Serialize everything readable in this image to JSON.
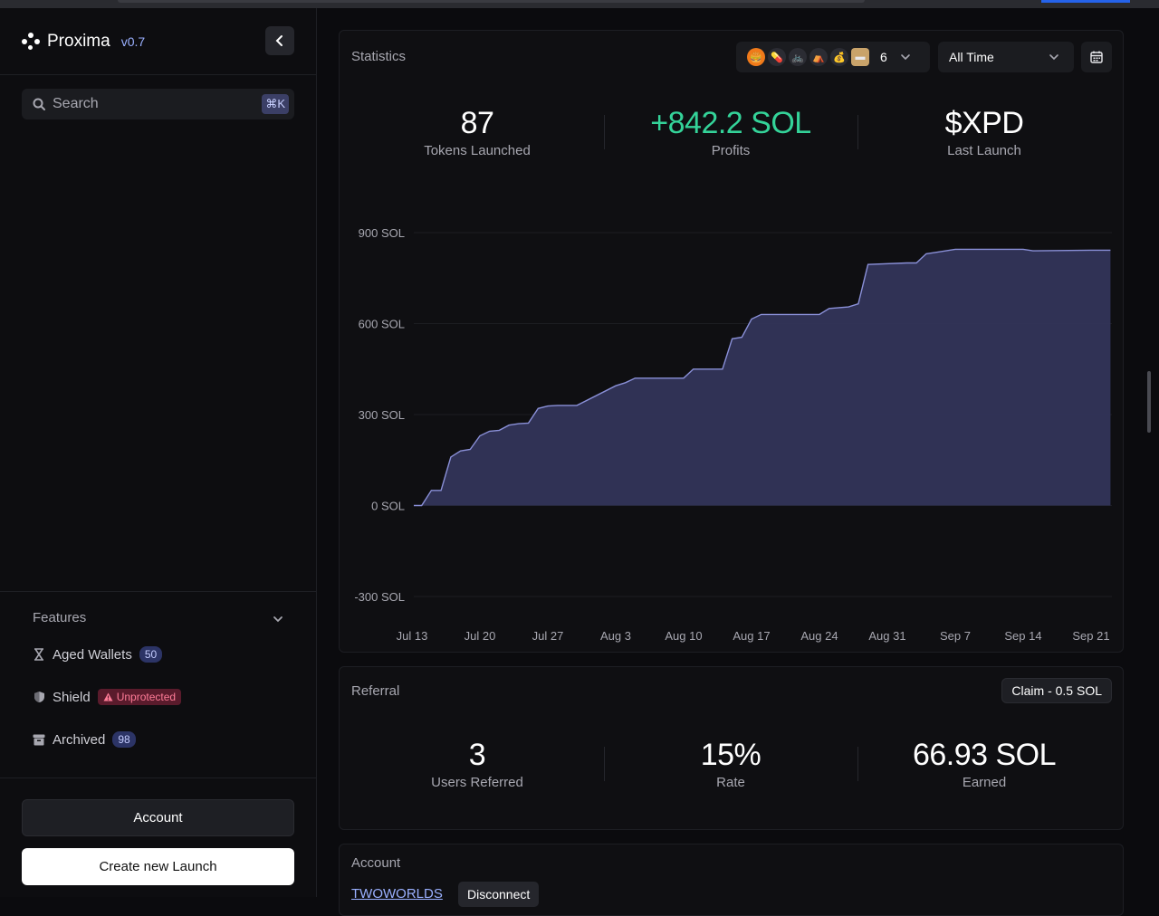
{
  "brand": {
    "name": "Proxima",
    "version": "v0.7"
  },
  "search": {
    "placeholder": "Search",
    "shortcut": "⌘K"
  },
  "features": {
    "title": "Features",
    "items": [
      {
        "label": "Aged Wallets",
        "badge": "50",
        "icon": "hourglass-icon"
      },
      {
        "label": "Shield",
        "badge": "Unprotected",
        "icon": "shield-icon"
      },
      {
        "label": "Archived",
        "badge": "98",
        "icon": "archive-icon"
      }
    ]
  },
  "buttons": {
    "account": "Account",
    "create": "Create new Launch"
  },
  "statistics": {
    "title": "Statistics",
    "token_count": "6",
    "range": "All Time",
    "stats": [
      {
        "value": "87",
        "label": "Tokens Launched"
      },
      {
        "value": "+842.2 SOL",
        "label": "Profits"
      },
      {
        "value": "$XPD",
        "label": "Last Launch"
      }
    ]
  },
  "referral": {
    "title": "Referral",
    "claim": "Claim - 0.5 SOL",
    "stats": [
      {
        "value": "3",
        "label": "Users Referred"
      },
      {
        "value": "15%",
        "label": "Rate"
      },
      {
        "value": "66.93 SOL",
        "label": "Earned"
      }
    ]
  },
  "account_section": {
    "title": "Account",
    "name": "TWOWORLDS",
    "disconnect": "Disconnect"
  },
  "colors": {
    "profit": "#34d399",
    "area_fill": "#33355a",
    "area_line": "#8a90d8",
    "accent": "#9ab0ff"
  },
  "chart_data": {
    "type": "area",
    "yticks": [
      "900 SOL",
      "600 SOL",
      "300 SOL",
      "0 SOL",
      "-300 SOL"
    ],
    "ytick_values": [
      900,
      600,
      300,
      0,
      -300
    ],
    "ylim": [
      -300,
      900
    ],
    "xticks": [
      "Jul 13",
      "Jul 20",
      "Jul 27",
      "Aug 3",
      "Aug 10",
      "Aug 17",
      "Aug 24",
      "Aug 31",
      "Sep 7",
      "Sep 14",
      "Sep 21"
    ],
    "series": [
      {
        "x": [
          "Jul 13",
          "Jul 14",
          "Jul 15",
          "Jul 16",
          "Jul 17",
          "Jul 18",
          "Jul 19",
          "Jul 20",
          "Jul 21",
          "Jul 22",
          "Jul 23",
          "Jul 24",
          "Jul 25",
          "Jul 26",
          "Jul 27",
          "Jul 28",
          "Jul 29",
          "Jul 30",
          "Aug 3",
          "Aug 4",
          "Aug 5",
          "Aug 7",
          "Aug 10",
          "Aug 11",
          "Aug 14",
          "Aug 15",
          "Aug 16",
          "Aug 17",
          "Aug 18",
          "Aug 24",
          "Aug 25",
          "Aug 27",
          "Aug 28",
          "Aug 29",
          "Sep 2",
          "Sep 3",
          "Sep 4",
          "Sep 5",
          "Sep 7",
          "Sep 14",
          "Sep 15",
          "Sep 21",
          "Sep 23"
        ],
        "values": [
          0,
          0,
          50,
          50,
          160,
          180,
          185,
          230,
          245,
          248,
          265,
          270,
          272,
          320,
          328,
          330,
          330,
          330,
          395,
          405,
          420,
          420,
          420,
          450,
          450,
          550,
          555,
          615,
          630,
          630,
          650,
          655,
          665,
          795,
          800,
          800,
          830,
          835,
          845,
          845,
          840,
          842,
          842
        ]
      }
    ]
  }
}
